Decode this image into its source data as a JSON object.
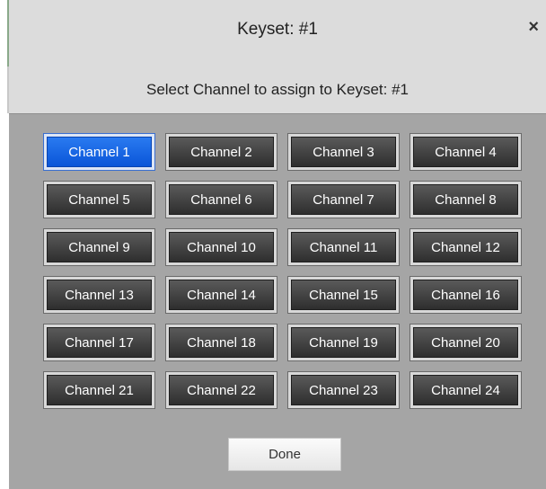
{
  "dialog": {
    "title": "Keyset: #1",
    "close_glyph": "×",
    "subtitle": "Select Channel to assign to Keyset: #1",
    "selected_channel": "Channel 1",
    "channels": [
      "Channel 1",
      "Channel 2",
      "Channel 3",
      "Channel 4",
      "Channel 5",
      "Channel 6",
      "Channel 7",
      "Channel 8",
      "Channel 9",
      "Channel 10",
      "Channel 11",
      "Channel 12",
      "Channel 13",
      "Channel 14",
      "Channel 15",
      "Channel 16",
      "Channel 17",
      "Channel 18",
      "Channel 19",
      "Channel 20",
      "Channel 21",
      "Channel 22",
      "Channel 23",
      "Channel 24"
    ],
    "done_label": "Done"
  },
  "colors": {
    "selected_accent": "#0a55d8",
    "button_dark": "#2e2e2e",
    "panel_bg": "#a5a5a5",
    "header_bg": "#dcdcdc"
  }
}
